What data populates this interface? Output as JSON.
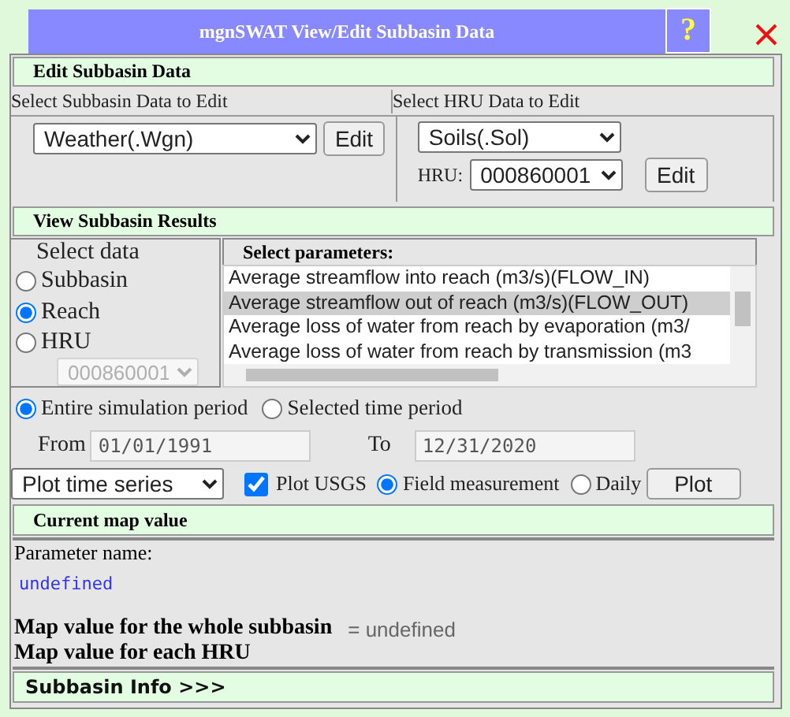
{
  "window": {
    "title": "mgnSWAT View/Edit Subbasin Data",
    "help": "?"
  },
  "edit_section": {
    "title": "Edit Subbasin Data",
    "subbasin": {
      "label": "Select Subbasin Data to Edit",
      "value": "Weather(.Wgn)",
      "button": "Edit"
    },
    "hru": {
      "label": "Select HRU Data to Edit",
      "value": "Soils(.Sol)",
      "hru_label": "HRU:",
      "hru_value": "000860001",
      "button": "Edit"
    }
  },
  "results_section": {
    "title": "View Subbasin Results",
    "select_data": {
      "title": "Select data",
      "hru_value": "000860001",
      "hru_disabled": true,
      "options": [
        {
          "label": "Subbasin",
          "selected": false
        },
        {
          "label": "Reach",
          "selected": true
        },
        {
          "label": "HRU",
          "selected": false
        }
      ]
    },
    "parameters": {
      "title": "Select parameters:",
      "items": [
        {
          "label": "Average streamflow into reach (m3/s)(FLOW_IN)",
          "selected": false
        },
        {
          "label": "Average streamflow out of reach (m3/s)(FLOW_OUT)",
          "selected": true
        },
        {
          "label": "Average loss of water from reach by evaporation (m3/",
          "selected": false
        },
        {
          "label": "Average loss of water from reach by transmission (m3",
          "selected": false
        }
      ]
    },
    "period": [
      {
        "label": "Entire simulation period",
        "selected": true
      },
      {
        "label": "Selected time period",
        "selected": false
      }
    ],
    "from": {
      "label": "From",
      "value": "01/01/1991"
    },
    "to": {
      "label": "To",
      "value": "12/31/2020"
    },
    "plot_type": "Plot time series",
    "plot_usgs": {
      "label": "Plot USGS",
      "checked": true
    },
    "measure": [
      {
        "label": "Field measurement",
        "selected": true
      },
      {
        "label": "Daily",
        "selected": false
      }
    ],
    "plot_button": "Plot"
  },
  "map_section": {
    "title": "Current map value",
    "parameter_label": "Parameter name:",
    "parameter_value": "undefined",
    "whole_label": "Map value for the whole subbasin",
    "whole_value": "= undefined",
    "each_label": "Map value for each HRU"
  },
  "info_bar": "Subbasin Info >>>"
}
